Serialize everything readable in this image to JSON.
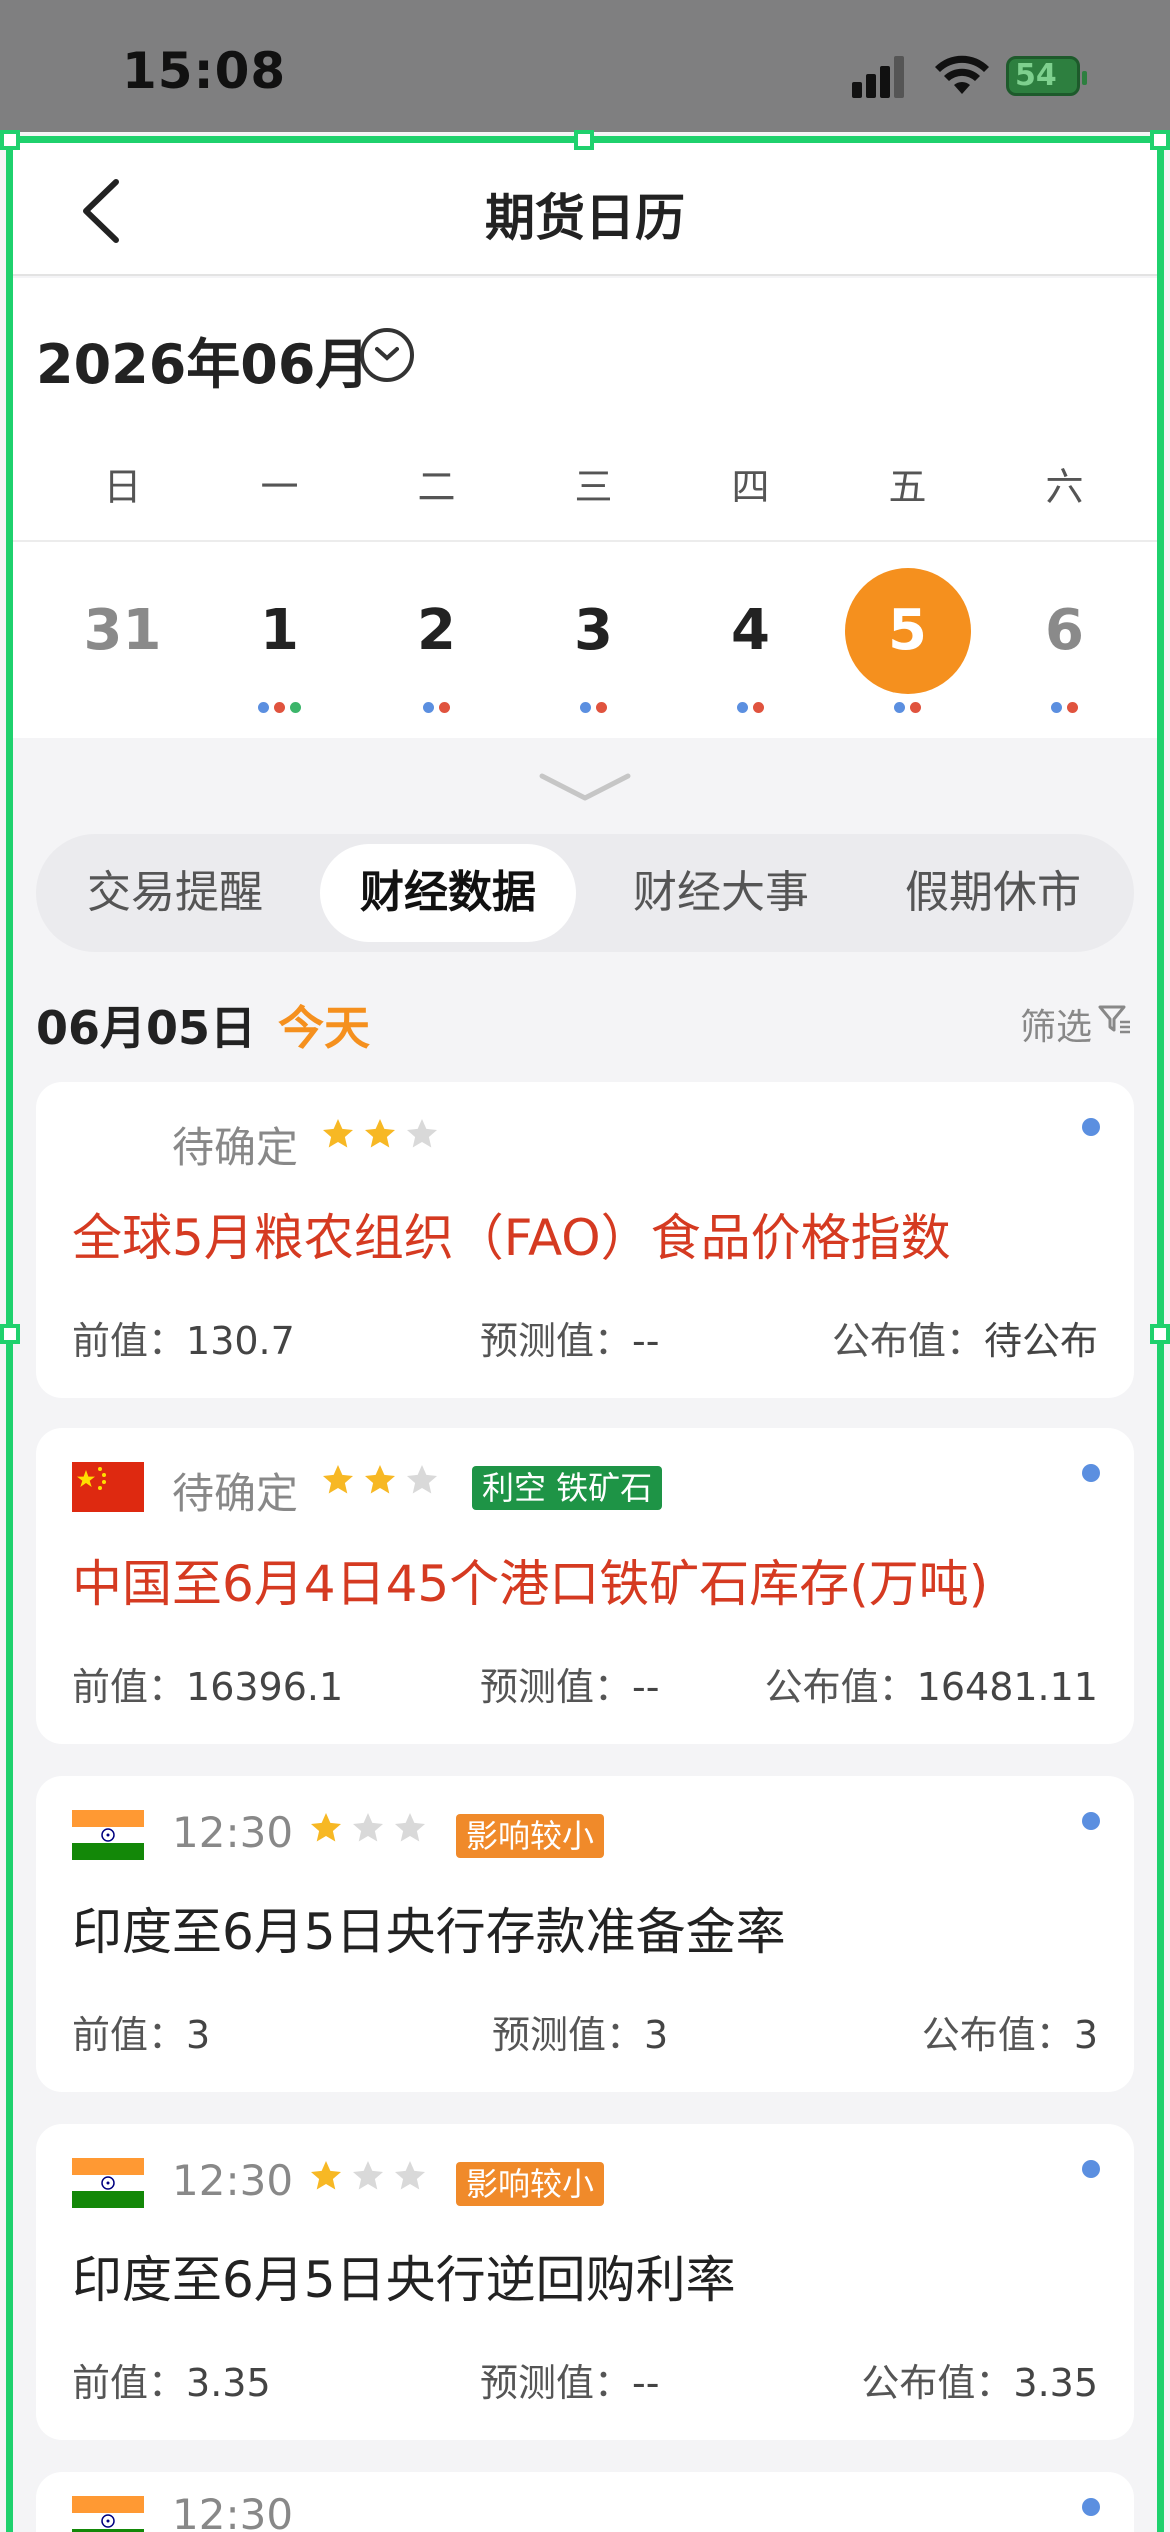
{
  "status_bar": {
    "time": "15:08",
    "battery": "54"
  },
  "nav": {
    "title": "期货日历"
  },
  "calendar": {
    "month_label": "2026年06月",
    "weekdays": [
      "日",
      "一",
      "二",
      "三",
      "四",
      "五",
      "六"
    ],
    "dates": [
      {
        "day": "31",
        "muted": true,
        "dots": []
      },
      {
        "day": "1",
        "muted": false,
        "dots": [
          "#5b8fe0",
          "#e0533e",
          "#3cb56a"
        ]
      },
      {
        "day": "2",
        "muted": false,
        "dots": [
          "#5b8fe0",
          "#e0533e"
        ]
      },
      {
        "day": "3",
        "muted": false,
        "dots": [
          "#5b8fe0",
          "#e0533e"
        ]
      },
      {
        "day": "4",
        "muted": false,
        "dots": [
          "#5b8fe0",
          "#e0533e"
        ]
      },
      {
        "day": "5",
        "muted": false,
        "selected": true,
        "dots": [
          "#5b8fe0",
          "#e0533e"
        ]
      },
      {
        "day": "6",
        "muted": true,
        "dots": [
          "#5b8fe0",
          "#e0533e"
        ]
      }
    ],
    "selected_color": "#f5901e"
  },
  "tabs": [
    {
      "label": "交易提醒",
      "active": false
    },
    {
      "label": "财经数据",
      "active": true
    },
    {
      "label": "财经大事",
      "active": false
    },
    {
      "label": "假期休市",
      "active": false
    }
  ],
  "day_header": {
    "date": "06月05日",
    "today": "今天",
    "filter": "筛选"
  },
  "events": [
    {
      "flag": "none",
      "time": "待确定",
      "stars": 2,
      "tag": null,
      "title": "全球5月粮农组织（FAO）食品价格指数",
      "title_highlight": true,
      "previous_label": "前值：",
      "previous": "130.7",
      "forecast_label": "预测值：",
      "forecast": "--",
      "actual_label": "公布值：",
      "actual": "待公布"
    },
    {
      "flag": "china",
      "time": "待确定",
      "stars": 2,
      "tag": {
        "text": "利空 铁矿石",
        "color": "#1e9446"
      },
      "title": "中国至6月4日45个港口铁矿石库存(万吨)",
      "title_highlight": true,
      "previous_label": "前值：",
      "previous": "16396.1",
      "forecast_label": "预测值：",
      "forecast": "--",
      "actual_label": "公布值：",
      "actual": "16481.11"
    },
    {
      "flag": "india",
      "time": "12:30",
      "stars": 1,
      "tag": {
        "text": "影响较小",
        "color": "#f08a2a"
      },
      "title": "印度至6月5日央行存款准备金率",
      "title_highlight": false,
      "previous_label": "前值：",
      "previous": "3",
      "forecast_label": "预测值：",
      "forecast": "3",
      "actual_label": "公布值：",
      "actual": "3"
    },
    {
      "flag": "india",
      "time": "12:30",
      "stars": 1,
      "tag": {
        "text": "影响较小",
        "color": "#f08a2a"
      },
      "title": "印度至6月5日央行逆回购利率",
      "title_highlight": false,
      "previous_label": "前值：",
      "previous": "3.35",
      "forecast_label": "预测值：",
      "forecast": "--",
      "actual_label": "公布值：",
      "actual": "3.35"
    }
  ],
  "partial_event": {
    "time": "12:30"
  }
}
